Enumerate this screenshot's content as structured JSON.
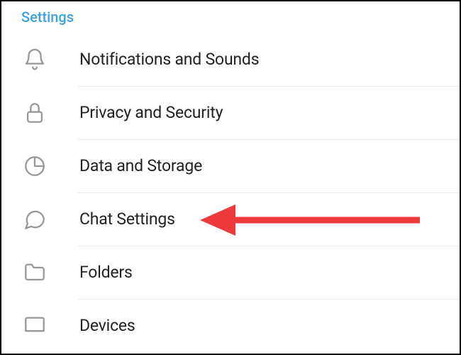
{
  "section": {
    "title": "Settings"
  },
  "items": [
    {
      "label": "Notifications and Sounds",
      "icon": "bell-icon"
    },
    {
      "label": "Privacy and Security",
      "icon": "lock-icon"
    },
    {
      "label": "Data and Storage",
      "icon": "pie-icon"
    },
    {
      "label": "Chat Settings",
      "icon": "chat-icon"
    },
    {
      "label": "Folders",
      "icon": "folder-icon"
    },
    {
      "label": "Devices",
      "icon": "device-icon"
    }
  ],
  "annotation": {
    "target_index": 3,
    "color": "#ee3a3a"
  }
}
